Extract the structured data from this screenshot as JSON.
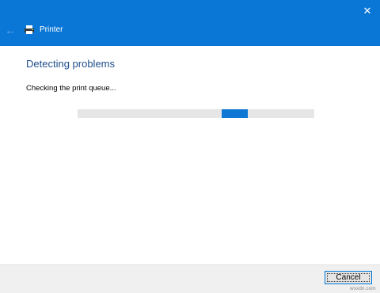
{
  "window": {
    "title": "Printer",
    "close_glyph": "✕",
    "back_glyph": "←"
  },
  "content": {
    "heading": "Detecting problems",
    "status": "Checking the print queue...",
    "progress": {
      "indeterminate": true,
      "chunk_position_fraction": 0.61
    }
  },
  "footer": {
    "cancel_label": "Cancel"
  },
  "watermark": "wsxdn.com",
  "colors": {
    "titlebar": "#0a77d6",
    "heading": "#1f4e8c",
    "progress_chunk": "#0f78d4",
    "progress_track": "#e6e6e6"
  }
}
